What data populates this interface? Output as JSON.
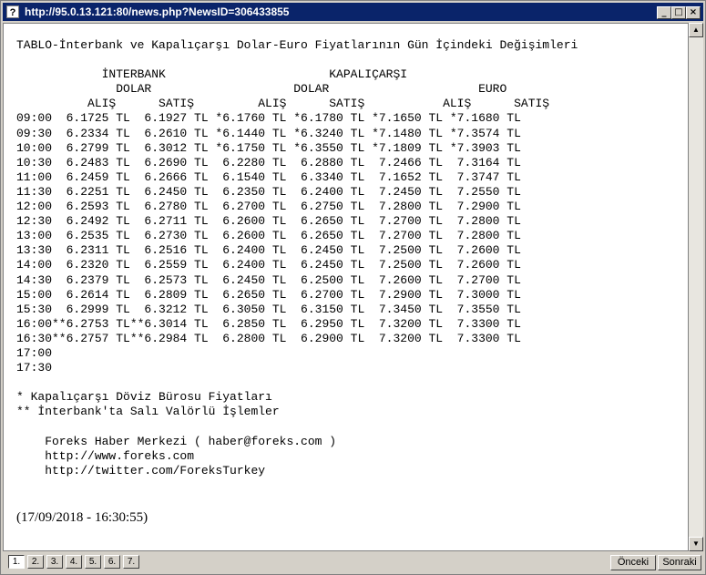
{
  "window": {
    "title": "http://95.0.13.121:80/news.php?NewsID=306433855",
    "icon": "question-icon",
    "controls": {
      "minimize": "_",
      "maximize": "□",
      "close": "×"
    }
  },
  "article": {
    "text": "TABLO-İnterbank ve Kapalıçarşı Dolar-Euro Fiyatlarının Gün İçindeki Değişimleri\n\n            İNTERBANK                       KAPALIÇARŞI\n              DOLAR                    DOLAR                     EURO\n          ALIŞ      SATIŞ         ALIŞ      SATIŞ           ALIŞ      SATIŞ\n09:00  6.1725 TL  6.1927 TL *6.1760 TL *6.1780 TL *7.1650 TL *7.1680 TL\n09:30  6.2334 TL  6.2610 TL *6.1440 TL *6.3240 TL *7.1480 TL *7.3574 TL\n10:00  6.2799 TL  6.3012 TL *6.1750 TL *6.3550 TL *7.1809 TL *7.3903 TL\n10:30  6.2483 TL  6.2690 TL  6.2280 TL  6.2880 TL  7.2466 TL  7.3164 TL\n11:00  6.2459 TL  6.2666 TL  6.1540 TL  6.3340 TL  7.1652 TL  7.3747 TL\n11:30  6.2251 TL  6.2450 TL  6.2350 TL  6.2400 TL  7.2450 TL  7.2550 TL\n12:00  6.2593 TL  6.2780 TL  6.2700 TL  6.2750 TL  7.2800 TL  7.2900 TL\n12:30  6.2492 TL  6.2711 TL  6.2600 TL  6.2650 TL  7.2700 TL  7.2800 TL\n13:00  6.2535 TL  6.2730 TL  6.2600 TL  6.2650 TL  7.2700 TL  7.2800 TL\n13:30  6.2311 TL  6.2516 TL  6.2400 TL  6.2450 TL  7.2500 TL  7.2600 TL\n14:00  6.2320 TL  6.2559 TL  6.2400 TL  6.2450 TL  7.2500 TL  7.2600 TL\n14:30  6.2379 TL  6.2573 TL  6.2450 TL  6.2500 TL  7.2600 TL  7.2700 TL\n15:00  6.2614 TL  6.2809 TL  6.2650 TL  6.2700 TL  7.2900 TL  7.3000 TL\n15:30  6.2999 TL  6.3212 TL  6.3050 TL  6.3150 TL  7.3450 TL  7.3550 TL\n16:00**6.2753 TL**6.3014 TL  6.2850 TL  6.2950 TL  7.3200 TL  7.3300 TL\n16:30**6.2757 TL**6.2984 TL  6.2800 TL  6.2900 TL  7.3200 TL  7.3300 TL\n17:00\n17:30\n\n* Kapalıçarşı Döviz Bürosu Fiyatları\n** İnterbank'ta Salı Valörlü İşlemler\n\n    Foreks Haber Merkezi ( haber@foreks.com )\n    http://www.foreks.com\n    http://twitter.com/ForeksTurkey",
    "datestamp": "(17/09/2018 - 16:30:55)"
  },
  "scrollbar": {
    "up_arrow": "▲",
    "down_arrow": "▼"
  },
  "pages": [
    "1.",
    "2.",
    "3.",
    "4.",
    "5.",
    "6.",
    "7."
  ],
  "nav": {
    "prev": "Önceki",
    "next": "Sonraki"
  }
}
